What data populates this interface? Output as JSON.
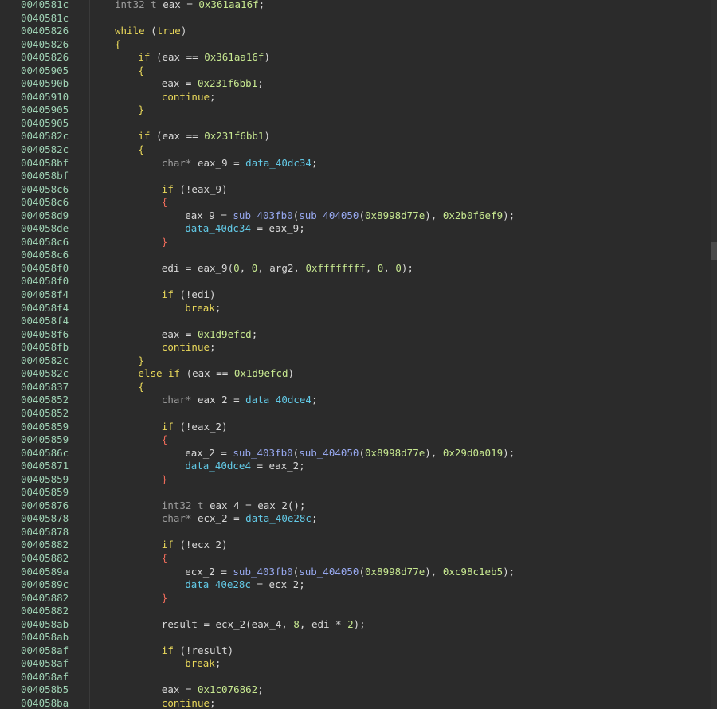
{
  "addresses": [
    "0040581c",
    "0040581c",
    "00405826",
    "00405826",
    "00405826",
    "00405905",
    "0040590b",
    "00405910",
    "00405905",
    "00405905",
    "0040582c",
    "0040582c",
    "004058bf",
    "004058bf",
    "004058c6",
    "004058c6",
    "004058d9",
    "004058de",
    "004058c6",
    "004058c6",
    "004058f0",
    "004058f0",
    "004058f4",
    "004058f4",
    "004058f4",
    "004058f6",
    "004058fb",
    "0040582c",
    "0040582c",
    "00405837",
    "00405852",
    "00405852",
    "00405859",
    "00405859",
    "0040586c",
    "00405871",
    "00405859",
    "00405859",
    "00405876",
    "00405878",
    "00405878",
    "00405882",
    "00405882",
    "0040589a",
    "0040589c",
    "00405882",
    "00405882",
    "004058ab",
    "004058ab",
    "004058af",
    "004058af",
    "004058af",
    "004058b5",
    "004058ba"
  ],
  "code_lines": [
    {
      "indent": 1,
      "tokens": [
        [
          "type",
          "int32_t"
        ],
        [
          "t",
          " eax = "
        ],
        [
          "num",
          "0x361aa16f"
        ],
        [
          "t",
          ";"
        ]
      ]
    },
    {
      "indent": 0,
      "tokens": []
    },
    {
      "indent": 1,
      "tokens": [
        [
          "kw",
          "while"
        ],
        [
          "t",
          " ("
        ],
        [
          "kw",
          "true"
        ],
        [
          "t",
          ")"
        ]
      ]
    },
    {
      "indent": 1,
      "tokens": [
        [
          "brace",
          "{"
        ]
      ]
    },
    {
      "indent": 2,
      "tokens": [
        [
          "kw",
          "if"
        ],
        [
          "t",
          " (eax == "
        ],
        [
          "num",
          "0x361aa16f"
        ],
        [
          "t",
          ")"
        ]
      ]
    },
    {
      "indent": 2,
      "tokens": [
        [
          "brace",
          "{"
        ]
      ]
    },
    {
      "indent": 3,
      "tokens": [
        [
          "t",
          "eax = "
        ],
        [
          "num",
          "0x231f6bb1"
        ],
        [
          "t",
          ";"
        ]
      ]
    },
    {
      "indent": 3,
      "tokens": [
        [
          "kw",
          "continue"
        ],
        [
          "t",
          ";"
        ]
      ]
    },
    {
      "indent": 2,
      "tokens": [
        [
          "brace",
          "}"
        ]
      ]
    },
    {
      "indent": 0,
      "tokens": []
    },
    {
      "indent": 2,
      "tokens": [
        [
          "kw",
          "if"
        ],
        [
          "t",
          " (eax == "
        ],
        [
          "num",
          "0x231f6bb1"
        ],
        [
          "t",
          ")"
        ]
      ]
    },
    {
      "indent": 2,
      "tokens": [
        [
          "brace",
          "{"
        ]
      ]
    },
    {
      "indent": 3,
      "tokens": [
        [
          "type",
          "char*"
        ],
        [
          "t",
          " eax_9 = "
        ],
        [
          "data",
          "data_40dc34"
        ],
        [
          "t",
          ";"
        ]
      ]
    },
    {
      "indent": 0,
      "tokens": []
    },
    {
      "indent": 3,
      "tokens": [
        [
          "kw",
          "if"
        ],
        [
          "t",
          " (!eax_9)"
        ]
      ]
    },
    {
      "indent": 3,
      "tokens": [
        [
          "bracer",
          "{"
        ]
      ]
    },
    {
      "indent": 4,
      "tokens": [
        [
          "t",
          "eax_9 = "
        ],
        [
          "func",
          "sub_403fb0"
        ],
        [
          "t",
          "("
        ],
        [
          "func",
          "sub_404050"
        ],
        [
          "t",
          "("
        ],
        [
          "num",
          "0x8998d77e"
        ],
        [
          "t",
          "), "
        ],
        [
          "num",
          "0x2b0f6ef9"
        ],
        [
          "t",
          ");"
        ]
      ]
    },
    {
      "indent": 4,
      "tokens": [
        [
          "data",
          "data_40dc34"
        ],
        [
          "t",
          " = eax_9;"
        ]
      ]
    },
    {
      "indent": 3,
      "tokens": [
        [
          "bracer",
          "}"
        ]
      ]
    },
    {
      "indent": 0,
      "tokens": []
    },
    {
      "indent": 3,
      "tokens": [
        [
          "t",
          "edi = eax_9("
        ],
        [
          "num",
          "0"
        ],
        [
          "t",
          ", "
        ],
        [
          "num",
          "0"
        ],
        [
          "t",
          ", arg2, "
        ],
        [
          "num",
          "0xffffffff"
        ],
        [
          "t",
          ", "
        ],
        [
          "num",
          "0"
        ],
        [
          "t",
          ", "
        ],
        [
          "num",
          "0"
        ],
        [
          "t",
          ");"
        ]
      ]
    },
    {
      "indent": 0,
      "tokens": []
    },
    {
      "indent": 3,
      "tokens": [
        [
          "kw",
          "if"
        ],
        [
          "t",
          " (!edi)"
        ]
      ]
    },
    {
      "indent": 4,
      "tokens": [
        [
          "kw",
          "break"
        ],
        [
          "t",
          ";"
        ]
      ]
    },
    {
      "indent": 0,
      "tokens": []
    },
    {
      "indent": 3,
      "tokens": [
        [
          "t",
          "eax = "
        ],
        [
          "num",
          "0x1d9efcd"
        ],
        [
          "t",
          ";"
        ]
      ]
    },
    {
      "indent": 3,
      "tokens": [
        [
          "kw",
          "continue"
        ],
        [
          "t",
          ";"
        ]
      ]
    },
    {
      "indent": 2,
      "tokens": [
        [
          "brace",
          "}"
        ]
      ]
    },
    {
      "indent": 2,
      "tokens": [
        [
          "kw",
          "else if"
        ],
        [
          "t",
          " (eax == "
        ],
        [
          "num",
          "0x1d9efcd"
        ],
        [
          "t",
          ")"
        ]
      ]
    },
    {
      "indent": 2,
      "tokens": [
        [
          "brace",
          "{"
        ]
      ]
    },
    {
      "indent": 3,
      "tokens": [
        [
          "type",
          "char*"
        ],
        [
          "t",
          " eax_2 = "
        ],
        [
          "data",
          "data_40dce4"
        ],
        [
          "t",
          ";"
        ]
      ]
    },
    {
      "indent": 0,
      "tokens": []
    },
    {
      "indent": 3,
      "tokens": [
        [
          "kw",
          "if"
        ],
        [
          "t",
          " (!eax_2)"
        ]
      ]
    },
    {
      "indent": 3,
      "tokens": [
        [
          "bracer",
          "{"
        ]
      ]
    },
    {
      "indent": 4,
      "tokens": [
        [
          "t",
          "eax_2 = "
        ],
        [
          "func",
          "sub_403fb0"
        ],
        [
          "t",
          "("
        ],
        [
          "func",
          "sub_404050"
        ],
        [
          "t",
          "("
        ],
        [
          "num",
          "0x8998d77e"
        ],
        [
          "t",
          "), "
        ],
        [
          "num",
          "0x29d0a019"
        ],
        [
          "t",
          ");"
        ]
      ]
    },
    {
      "indent": 4,
      "tokens": [
        [
          "data",
          "data_40dce4"
        ],
        [
          "t",
          " = eax_2;"
        ]
      ]
    },
    {
      "indent": 3,
      "tokens": [
        [
          "bracer",
          "}"
        ]
      ]
    },
    {
      "indent": 0,
      "tokens": []
    },
    {
      "indent": 3,
      "tokens": [
        [
          "type",
          "int32_t"
        ],
        [
          "t",
          " eax_4 = eax_2();"
        ]
      ]
    },
    {
      "indent": 3,
      "tokens": [
        [
          "type",
          "char*"
        ],
        [
          "t",
          " ecx_2 = "
        ],
        [
          "data",
          "data_40e28c"
        ],
        [
          "t",
          ";"
        ]
      ]
    },
    {
      "indent": 0,
      "tokens": []
    },
    {
      "indent": 3,
      "tokens": [
        [
          "kw",
          "if"
        ],
        [
          "t",
          " (!ecx_2)"
        ]
      ]
    },
    {
      "indent": 3,
      "tokens": [
        [
          "bracer",
          "{"
        ]
      ]
    },
    {
      "indent": 4,
      "tokens": [
        [
          "t",
          "ecx_2 = "
        ],
        [
          "func",
          "sub_403fb0"
        ],
        [
          "t",
          "("
        ],
        [
          "func",
          "sub_404050"
        ],
        [
          "t",
          "("
        ],
        [
          "num",
          "0x8998d77e"
        ],
        [
          "t",
          "), "
        ],
        [
          "num",
          "0xc98c1eb5"
        ],
        [
          "t",
          ");"
        ]
      ]
    },
    {
      "indent": 4,
      "tokens": [
        [
          "data",
          "data_40e28c"
        ],
        [
          "t",
          " = ecx_2;"
        ]
      ]
    },
    {
      "indent": 3,
      "tokens": [
        [
          "bracer",
          "}"
        ]
      ]
    },
    {
      "indent": 0,
      "tokens": []
    },
    {
      "indent": 3,
      "tokens": [
        [
          "t",
          "result = ecx_2(eax_4, "
        ],
        [
          "num",
          "8"
        ],
        [
          "t",
          ", edi * "
        ],
        [
          "num",
          "2"
        ],
        [
          "t",
          ");"
        ]
      ]
    },
    {
      "indent": 0,
      "tokens": []
    },
    {
      "indent": 3,
      "tokens": [
        [
          "kw",
          "if"
        ],
        [
          "t",
          " (!result)"
        ]
      ]
    },
    {
      "indent": 4,
      "tokens": [
        [
          "kw",
          "break"
        ],
        [
          "t",
          ";"
        ]
      ]
    },
    {
      "indent": 0,
      "tokens": []
    },
    {
      "indent": 3,
      "tokens": [
        [
          "t",
          "eax = "
        ],
        [
          "num",
          "0x1c076862"
        ],
        [
          "t",
          ";"
        ]
      ]
    },
    {
      "indent": 3,
      "tokens": [
        [
          "kw",
          "continue"
        ],
        [
          "t",
          ";"
        ]
      ]
    }
  ],
  "colors": {
    "background": "#2b2b2b",
    "address": "#9fd2b4",
    "keyword": "#e8d75a",
    "number": "#c7e890",
    "data_symbol": "#62c9e6",
    "function": "#97a8ef",
    "type": "#9b9b9b"
  }
}
